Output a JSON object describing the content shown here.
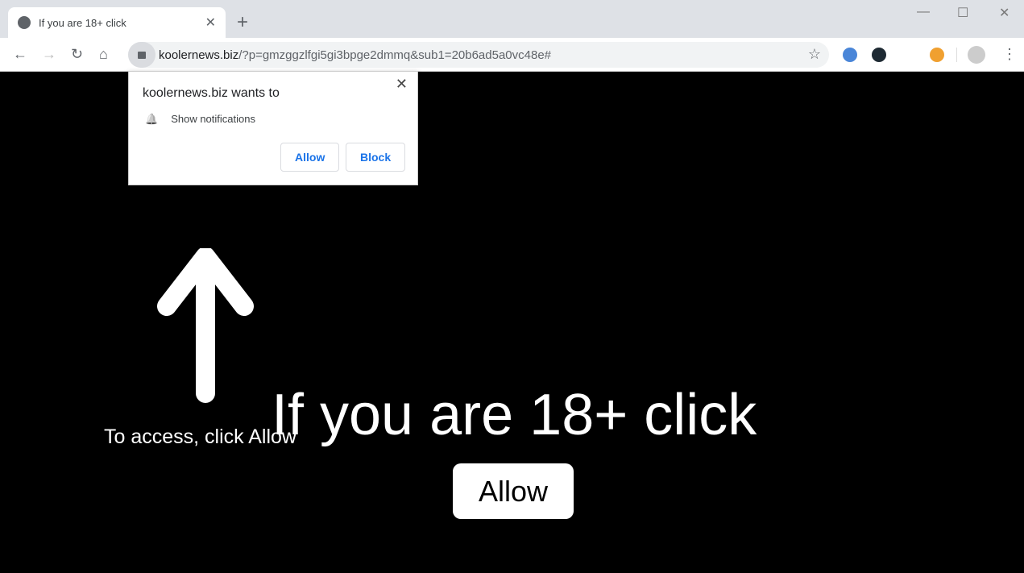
{
  "tab": {
    "title": "If you are 18+ click",
    "favicon": "globe-icon"
  },
  "address": {
    "host": "koolernews.biz",
    "path": "/?p=gmzggzlfgi5gi3bpge2dmmq&sub1=20b6ad5a0vc48e#"
  },
  "popup": {
    "heading": "koolernews.biz wants to",
    "permission": "Show notifications",
    "allow": "Allow",
    "block": "Block"
  },
  "page": {
    "access_text": "To access, click Allow",
    "headline": "If you are 18+ click",
    "allow_button": "Allow"
  },
  "glyphs": {
    "close": "✕",
    "plus": "+",
    "back": "←",
    "forward": "→",
    "reload": "↻",
    "home": "⌂",
    "lock": "🔒",
    "star": "☆",
    "menu": "⋮",
    "bell": "🔔",
    "min": "—",
    "max": "☐"
  }
}
